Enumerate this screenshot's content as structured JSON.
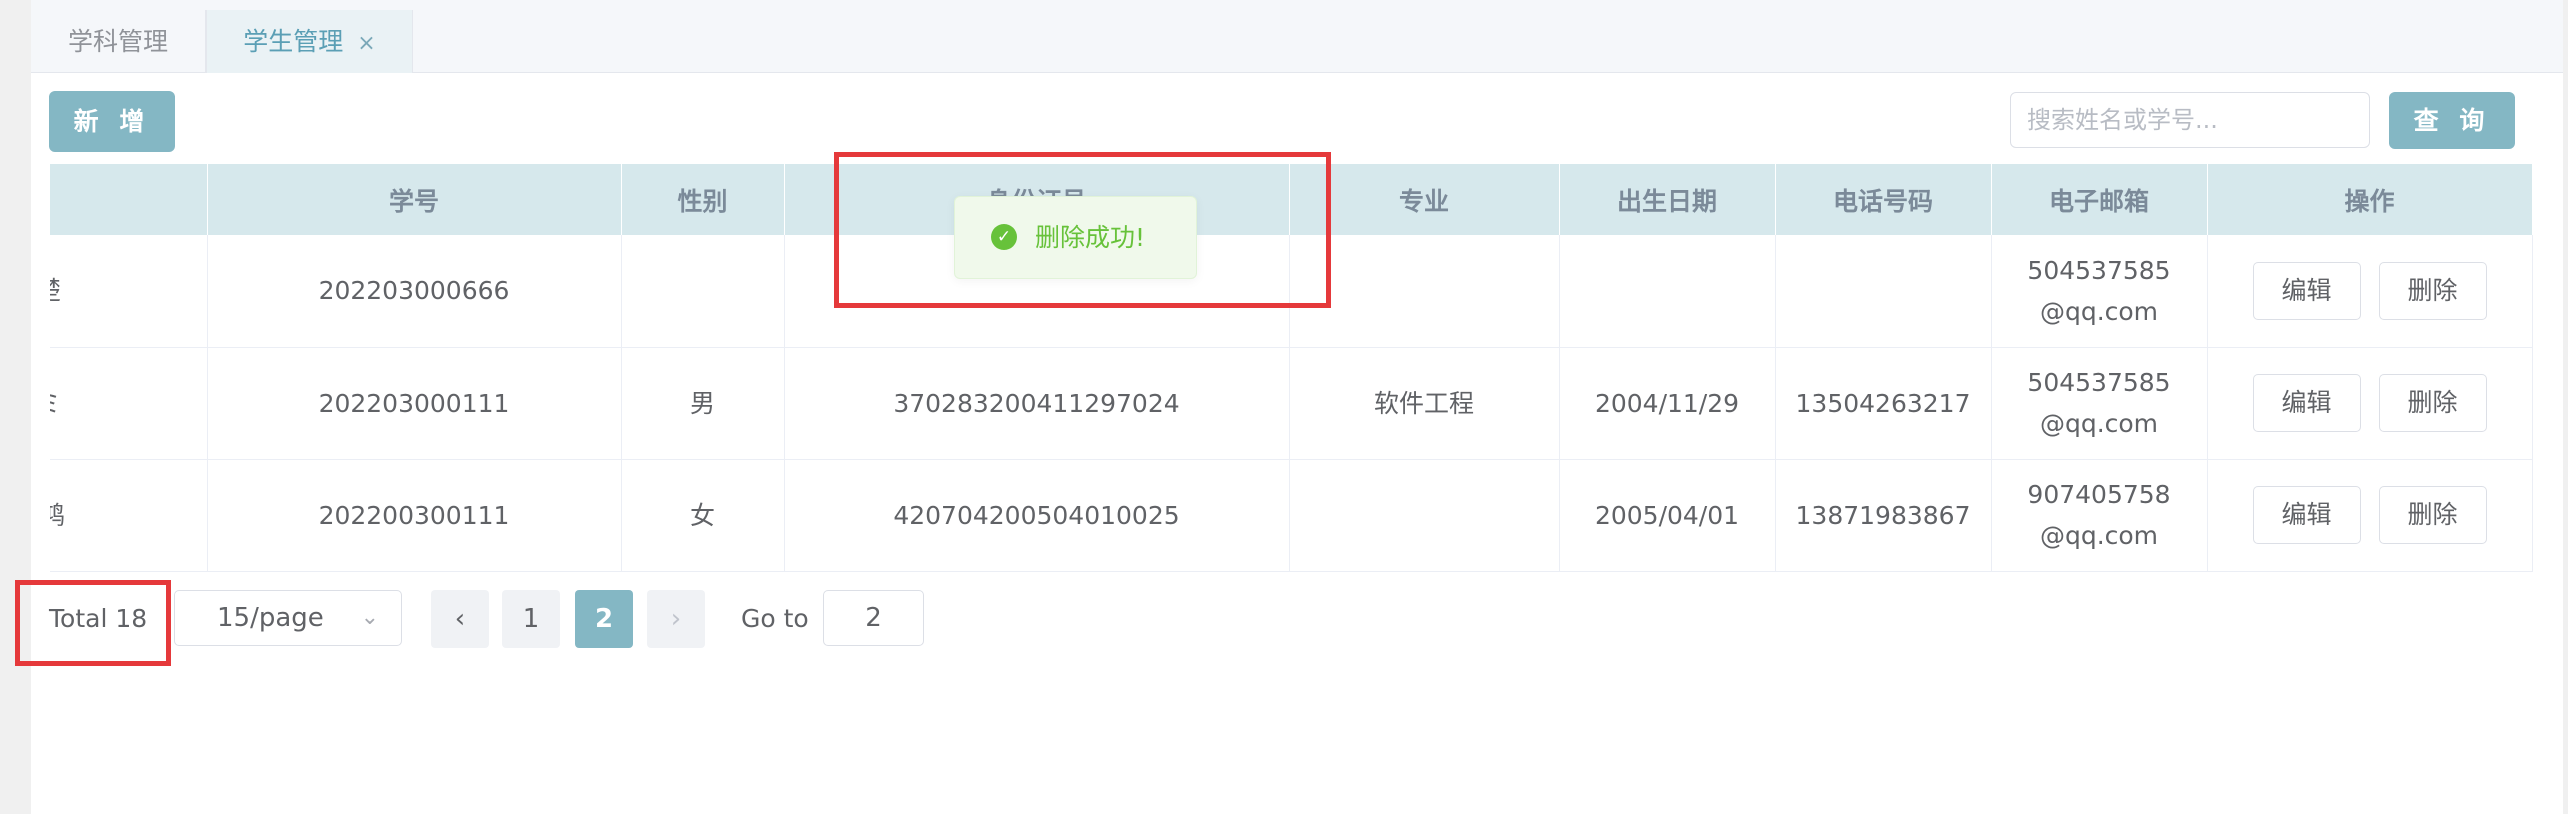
{
  "tabs": [
    {
      "label": "学科管理"
    },
    {
      "label": "学生管理",
      "close": "×"
    }
  ],
  "toolbar": {
    "add_label": "新 增",
    "search_placeholder": "搜索姓名或学号...",
    "query_label": "查 询"
  },
  "table": {
    "headers": [
      "",
      "学号",
      "性别",
      "身份证号",
      "专业",
      "出生日期",
      "电话号码",
      "电子邮箱",
      "操作"
    ],
    "rows": [
      {
        "name": "楚",
        "id": "202203000666",
        "gender": "",
        "idcard": "",
        "major": "",
        "birth": "",
        "phone": "",
        "email": "504537585@qq.com"
      },
      {
        "name": "ミ",
        "id": "202203000111",
        "gender": "男",
        "idcard": "370283200411297024",
        "major": "软件工程",
        "birth": "2004/11/29",
        "phone": "13504263217",
        "email": "504537585@qq.com"
      },
      {
        "name": "鸿",
        "id": "202200300111",
        "gender": "女",
        "idcard": "420704200504010025",
        "major": "",
        "birth": "2005/04/01",
        "phone": "13871983867",
        "email": "907405758@qq.com"
      }
    ],
    "edit_label": "编辑",
    "delete_label": "删除"
  },
  "pagination": {
    "total": "Total 18",
    "page_size": "15/page",
    "pages": [
      "1",
      "2"
    ],
    "current_page": "2",
    "goto_label": "Go to",
    "goto_value": "2"
  },
  "toast": {
    "message": "删除成功!"
  },
  "colors": {
    "accent": "#84b7c4",
    "highlight": "#e5393b",
    "success": "#67c23a"
  }
}
